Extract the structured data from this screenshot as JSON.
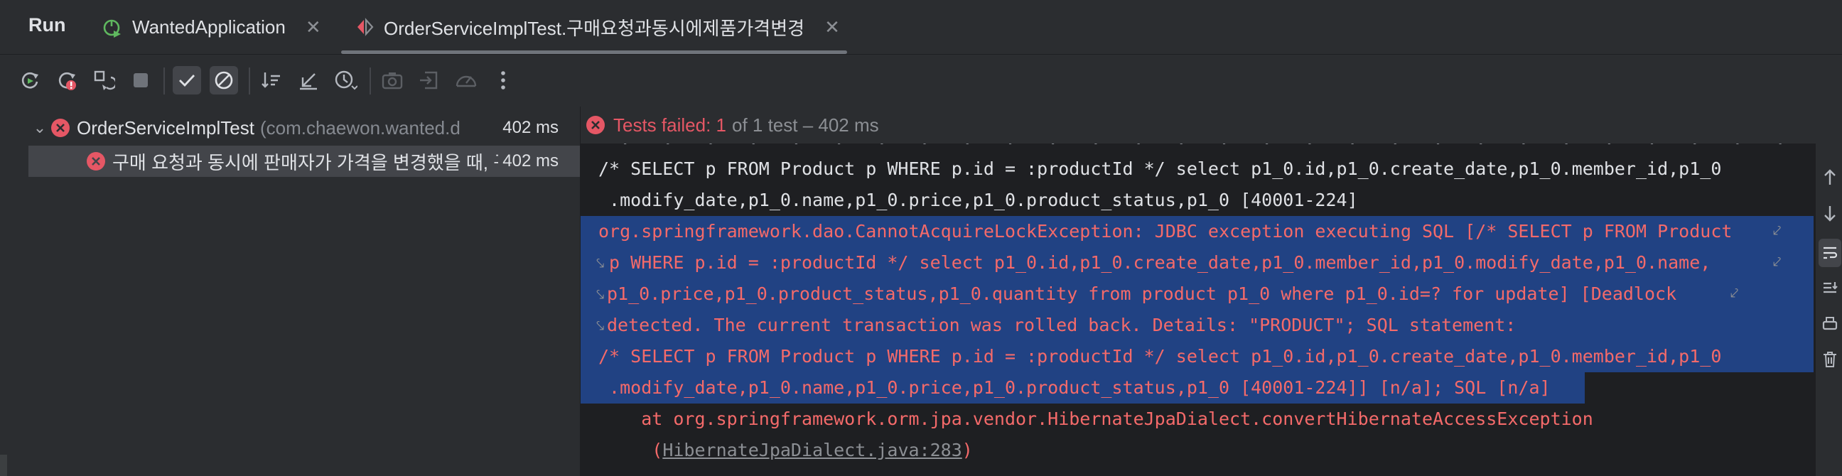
{
  "header": {
    "panel_title": "Run",
    "tabs": [
      {
        "label": "WantedApplication",
        "icon": "spring-boot-run-icon"
      },
      {
        "label": "OrderServiceImplTest.구매요청과동시에제품가격변경",
        "icon": "junit-test-icon",
        "active": true
      }
    ]
  },
  "toolbar": {
    "items": [
      "rerun-icon",
      "rerun-failed-icon",
      "toggle-auto-test-icon",
      "stop-icon",
      "show-passed-icon",
      "show-ignored-icon",
      "sort-icon",
      "collapse-icon",
      "history-icon",
      "screenshot-icon",
      "export-icon",
      "coverage-icon",
      "more-icon"
    ]
  },
  "tree": {
    "root": {
      "name": "OrderServiceImplTest",
      "package": "(com.chaewon.wanted.d",
      "time": "402 ms"
    },
    "child": {
      "name": "구매 요청과 동시에 판매자가 가격을 변경했을 때, 구!",
      "time": "402 ms"
    }
  },
  "status": {
    "failed_text": "Tests failed: 1",
    "rest_text": "of 1 test – 402 ms"
  },
  "console": {
    "cut_line": "  .   .   .   .   .   .   .   .   .   .   .   .   .   .   .   .   .   .   .   .   .   .   .   .   .   .   .   .   .   .   .  (",
    "lines": [
      "/* SELECT p FROM Product p WHERE p.id = :productId */ select p1_0.id,p1_0.create_date,p1_0.member_id,p1_0",
      " .modify_date,p1_0.name,p1_0.price,p1_0.product_status,p1_0 [40001-224]",
      "org.springframework.dao.CannotAcquireLockException: JDBC exception executing SQL [/* SELECT p FROM Product",
      " p WHERE p.id = :productId */ select p1_0.id,p1_0.create_date,p1_0.member_id,p1_0.modify_date,p1_0.name,",
      "p1_0.price,p1_0.product_status,p1_0.quantity from product p1_0 where p1_0.id=? for update] [Deadlock",
      "detected. The current transaction was rolled back. Details: \"PRODUCT\"; SQL statement:",
      "/* SELECT p FROM Product p WHERE p.id = :productId */ select p1_0.id,p1_0.create_date,p1_0.member_id,p1_0",
      " .modify_date,p1_0.name,p1_0.price,p1_0.product_status,p1_0 [40001-224]] [n/a]; SQL [n/a]",
      "    at org.springframework.orm.jpa.vendor.HibernateJpaDialect.convertHibernateAccessException"
    ],
    "link_prefix": "     (",
    "link_text": "HibernateJpaDialect.java:283",
    "link_suffix": ")"
  },
  "right_tools": [
    "scroll-up-icon",
    "scroll-down-icon",
    "soft-wrap-icon",
    "scroll-to-end-icon",
    "print-icon",
    "clear-all-icon"
  ],
  "colors": {
    "error": "#e55765",
    "selection": "#214283",
    "console_bg": "#1e1f22",
    "panel_bg": "#2b2d30"
  }
}
